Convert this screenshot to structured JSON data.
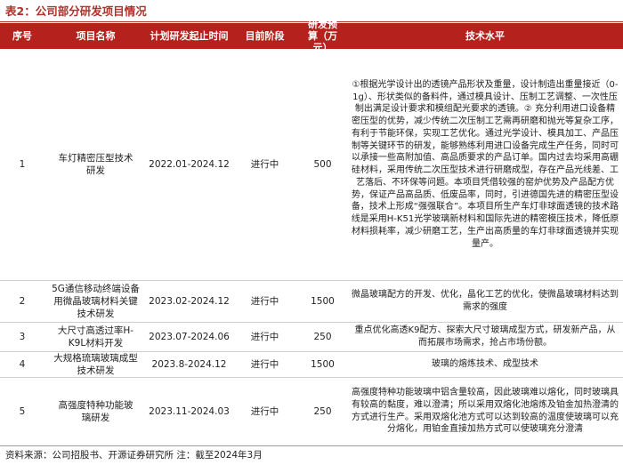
{
  "title": "表2：公司部分研发项目情况",
  "headers": {
    "seq": "序号",
    "name": "项目名称",
    "time": "计划研发起止时间",
    "stage": "目前阶段",
    "budget": "研发预算（万元）",
    "tech": "技术水平"
  },
  "rows": [
    {
      "seq": "1",
      "name": "车灯精密压型技术研发",
      "time": "2022.01-2024.12",
      "stage": "进行中",
      "budget": "500",
      "tech": "①根据光学设计出的透镜产品形状及重量，设计制造出重量接近（0-1g）、形状类似的备料件，通过模具设计、压制工艺调整、一次性压制出满足设计要求和模组配光要求的透镜。② 充分利用进口设备精密压型的优势，减少传统二次压制工艺需再研磨和抛光等复杂工序，有利于节能环保，实现工艺优化。通过光学设计、模具加工、产品压制等关键环节的研发，能够熟练利用进口设备完成生产任务，同时可以承接一些高附加值、高品质要求的产品订单。国内过去均采用高硼硅材料，采用传统二次压型技术进行研磨成型，存在产品光线差、工艺落后、不环保等问题。本项目凭借较强的窑炉优势及产品配方优势，保证产品高品质、低废品率，同时，引进德国先进的精密压型设备，技术上形成“强强联合”。本项目所生产车灯非球面透镜的技术路线是采用H-K51光学玻璃新材料和国际先进的精密模压技术，降低原材料损耗率，减少研磨工艺，生产出高质量的车灯非球面透镜并实现量产。"
    },
    {
      "seq": "2",
      "name": "5G通信移动终端设备用微晶玻璃材料关键技术研发",
      "time": "2023.02-2024.12",
      "stage": "进行中",
      "budget": "1500",
      "tech": "微晶玻璃配方的开发、优化，晶化工艺的优化，使微晶玻璃材料达到需求的强度"
    },
    {
      "seq": "3",
      "name": "大尺寸高透过率H-K9L材料开发",
      "time": "2023.07-2024.06",
      "stage": "进行中",
      "budget": "250",
      "tech": "重点优化高透K9配方、探索大尺寸玻璃成型方式，研发新产品，从而拓展市场需求，抢占市场份额。"
    },
    {
      "seq": "4",
      "name": "大规格琉璃玻璃成型技术研发",
      "time": "2023.8-2024.12",
      "stage": "进行中",
      "budget": "1500",
      "tech": "玻璃的熔炼技术、成型技术"
    },
    {
      "seq": "5",
      "name": "高强度特种功能玻璃研发",
      "time": "2023.11-2024.03",
      "stage": "进行中",
      "budget": "250",
      "tech": "高强度特种功能玻璃中铝含量较高，因此玻璃难以熔化，同时玻璃具有较高的黏度，难以澄清；所以采用双熔化池熔炼及铂金加热澄清的方式进行生产。采用双熔化池方式可以达到较高的温度使玻璃可以充分熔化，用铂金直接加热方式可以使玻璃充分澄清"
    }
  ],
  "source": "资料来源：公司招股书、开源证券研究所 注：截至2024年3月"
}
